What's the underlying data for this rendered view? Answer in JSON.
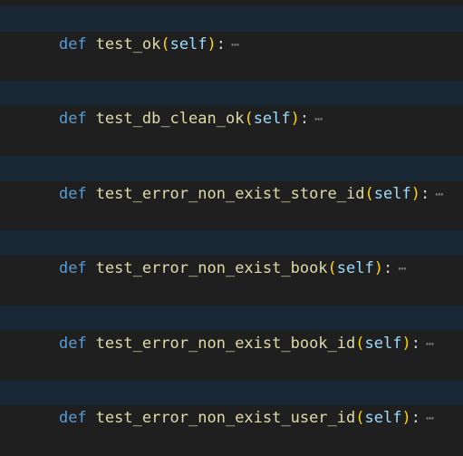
{
  "editor": {
    "keyword": "def",
    "self_param": "self",
    "open_paren": "(",
    "close_paren": ")",
    "colon": ":",
    "fold_marker": "⋯",
    "functions": [
      {
        "name": "test_ok"
      },
      {
        "name": "test_db_clean_ok"
      },
      {
        "name": "test_error_non_exist_store_id"
      },
      {
        "name": "test_error_non_exist_book"
      },
      {
        "name": "test_error_non_exist_book_id"
      },
      {
        "name": "test_error_non_exist_user_id"
      }
    ]
  }
}
